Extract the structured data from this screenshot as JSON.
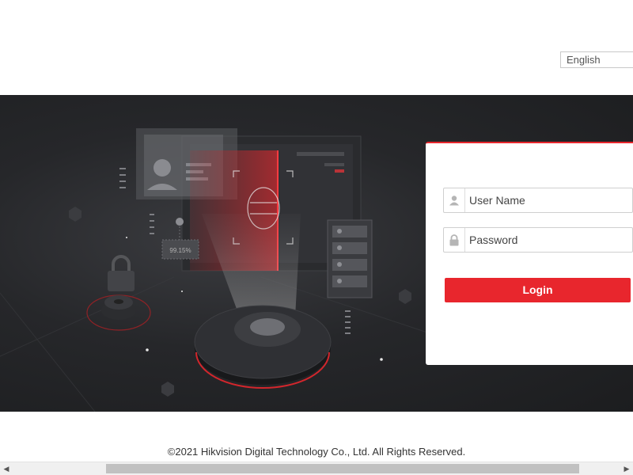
{
  "language": {
    "selected": "English"
  },
  "illustration": {
    "match_score": "99.15%"
  },
  "login": {
    "username_placeholder": "User Name",
    "password_placeholder": "Password",
    "button_label": "Login"
  },
  "footer": {
    "copyright": "©2021 Hikvision Digital Technology Co., Ltd. All Rights Reserved."
  },
  "colors": {
    "accent": "#e8262d",
    "hero_bg": "#26272a"
  },
  "icons": {
    "user": "user-icon",
    "lock": "lock-icon"
  }
}
